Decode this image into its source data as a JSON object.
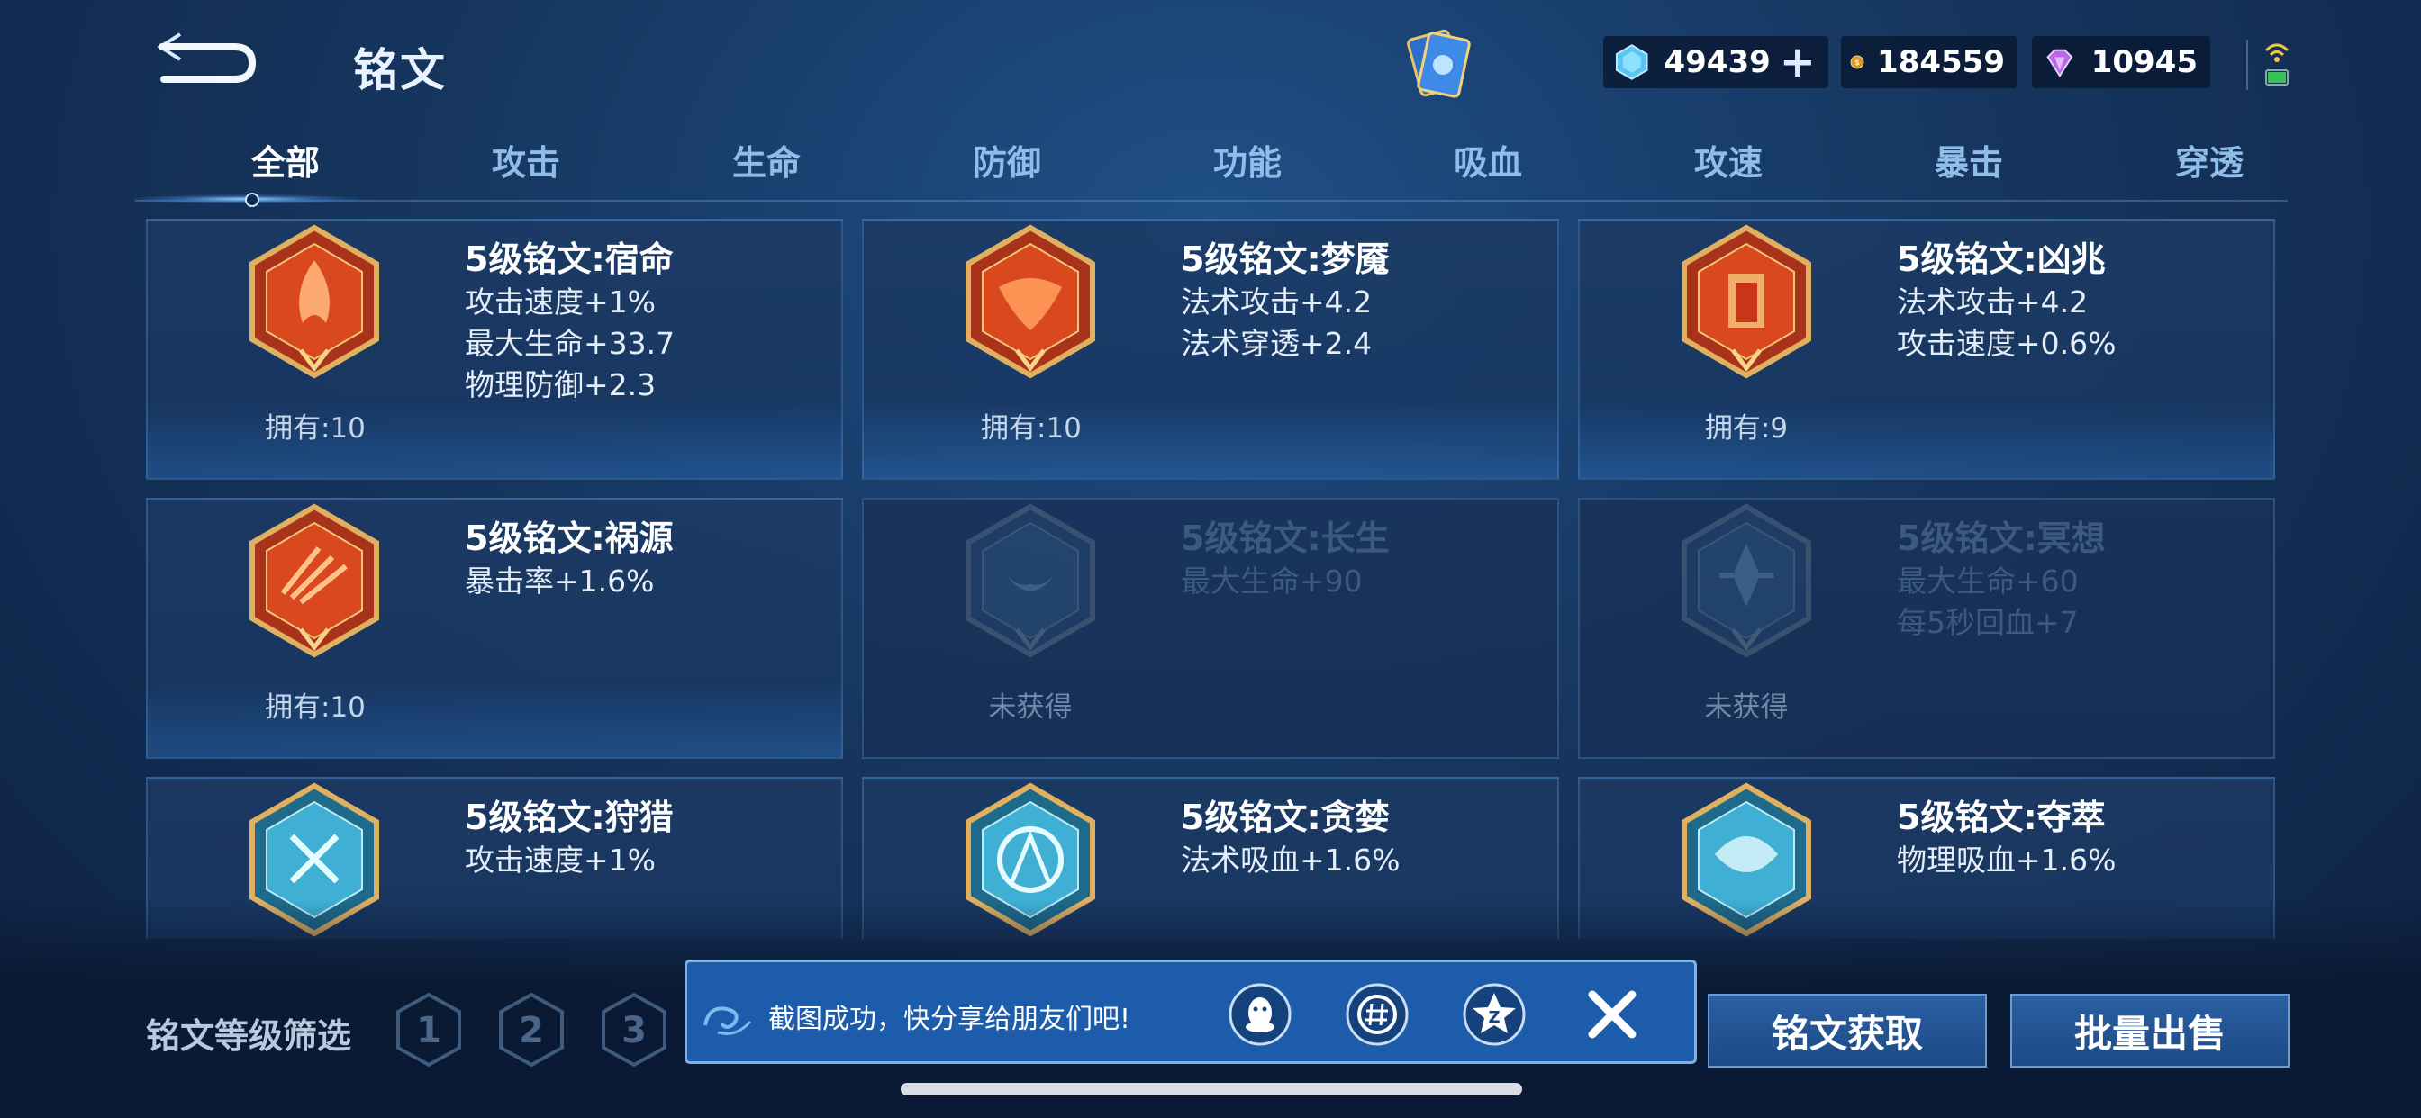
{
  "header": {
    "title": "铭文",
    "currencies": [
      {
        "icon": "diamond-icon",
        "value": "49439",
        "plus": "+"
      },
      {
        "icon": "gold-coin-icon",
        "value": "184559"
      },
      {
        "icon": "purple-crystal-icon",
        "value": "10945"
      }
    ]
  },
  "tabs": [
    {
      "label": "全部",
      "active": true
    },
    {
      "label": "攻击"
    },
    {
      "label": "生命"
    },
    {
      "label": "防御"
    },
    {
      "label": "功能"
    },
    {
      "label": "吸血"
    },
    {
      "label": "攻速"
    },
    {
      "label": "暴击"
    },
    {
      "label": "穿透"
    }
  ],
  "cards": [
    {
      "name": "5级铭文:宿命",
      "stats": [
        "攻击速度+1%",
        "最大生命+33.7",
        "物理防御+2.3"
      ],
      "owned": "拥有:10",
      "color": "red",
      "locked": false
    },
    {
      "name": "5级铭文:梦魇",
      "stats": [
        "法术攻击+4.2",
        "法术穿透+2.4"
      ],
      "owned": "拥有:10",
      "color": "red",
      "locked": false
    },
    {
      "name": "5级铭文:凶兆",
      "stats": [
        "法术攻击+4.2",
        "攻击速度+0.6%"
      ],
      "owned": "拥有:9",
      "color": "red",
      "locked": false
    },
    {
      "name": "5级铭文:祸源",
      "stats": [
        "暴击率+1.6%"
      ],
      "owned": "拥有:10",
      "color": "red",
      "locked": false
    },
    {
      "name": "5级铭文:长生",
      "stats": [
        "最大生命+90"
      ],
      "owned": "未获得",
      "color": "blue",
      "locked": true
    },
    {
      "name": "5级铭文:冥想",
      "stats": [
        "最大生命+60",
        "每5秒回血+7"
      ],
      "owned": "未获得",
      "color": "blue",
      "locked": true
    },
    {
      "name": "5级铭文:狩猎",
      "stats": [
        "攻击速度+1%"
      ],
      "owned": "",
      "color": "cyan",
      "locked": false
    },
    {
      "name": "5级铭文:贪婪",
      "stats": [
        "法术吸血+1.6%"
      ],
      "owned": "",
      "color": "cyan",
      "locked": false
    },
    {
      "name": "5级铭文:夺萃",
      "stats": [
        "物理吸血+1.6%"
      ],
      "owned": "",
      "color": "cyan",
      "locked": false
    }
  ],
  "bottom": {
    "filter_label": "铭文等级筛选",
    "levels": [
      "1",
      "2",
      "3"
    ],
    "get_button": "铭文获取",
    "sell_button": "批量出售"
  },
  "toast": {
    "message": "截图成功，快分享给朋友们吧!",
    "share_targets": [
      "qq-icon",
      "wechat-moments-icon",
      "qzone-icon"
    ],
    "close_icon": "close-icon"
  }
}
